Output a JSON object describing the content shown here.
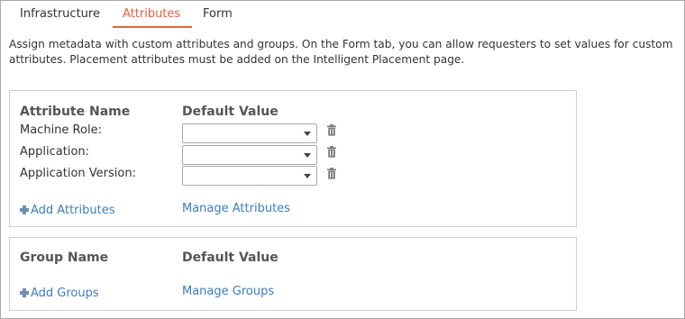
{
  "tabs": [
    {
      "label": "Infrastructure",
      "active": false
    },
    {
      "label": "Attributes",
      "active": true
    },
    {
      "label": "Form",
      "active": false
    }
  ],
  "description": "Assign metadata with custom attributes and groups. On the Form tab, you can allow requesters to set values for custom attributes. Placement attributes must be added on the Intelligent Placement page.",
  "attributes_panel": {
    "name_header": "Attribute Name",
    "value_header": "Default Value",
    "rows": [
      {
        "label": "Machine Role:",
        "value": ""
      },
      {
        "label": "Application:",
        "value": ""
      },
      {
        "label": "Application Version:",
        "value": ""
      }
    ],
    "add_link": "Add Attributes",
    "manage_link": "Manage Attributes"
  },
  "groups_panel": {
    "name_header": "Group Name",
    "value_header": "Default Value",
    "add_link": "Add Groups",
    "manage_link": "Manage Groups"
  },
  "colors": {
    "accent": "#e8613c",
    "link": "#3d7cbf",
    "border": "#cfcfcf",
    "text": "#333333"
  },
  "icons": {
    "delete": "trash-icon",
    "add": "plus-icon",
    "dropdown": "chevron-down-icon"
  }
}
